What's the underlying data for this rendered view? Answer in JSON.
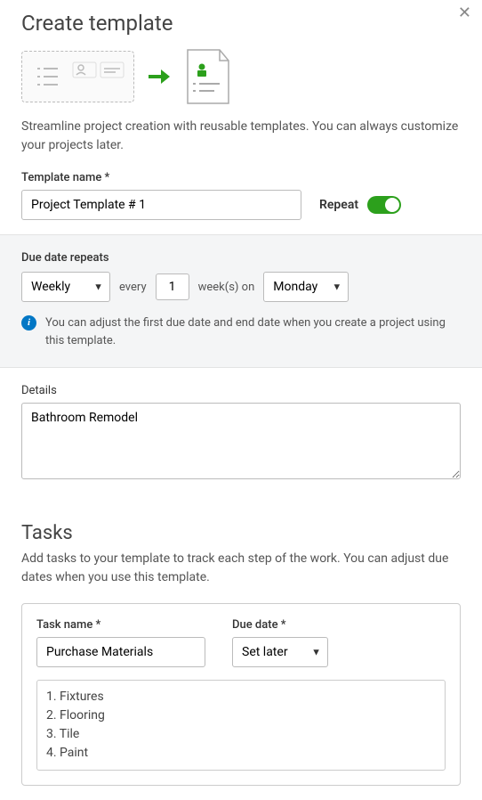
{
  "header": {
    "title": "Create template"
  },
  "description": "Streamline project creation with reusable templates. You can always customize your projects later.",
  "template_name": {
    "label": "Template name *",
    "value": "Project Template # 1"
  },
  "repeat": {
    "label": "Repeat",
    "on": true
  },
  "due_repeat": {
    "label": "Due date repeats",
    "frequency": "Weekly",
    "every_label": "every",
    "interval": "1",
    "unit_text": "week(s) on",
    "day": "Monday",
    "info": "You can adjust the first due date and end date when you create a project using this template."
  },
  "details": {
    "label": "Details",
    "value": "Bathroom Remodel"
  },
  "tasks": {
    "heading": "Tasks",
    "description": "Add tasks to your template to track each step of the work. You can adjust due dates when you use this template.",
    "task_name_label": "Task name *",
    "task_name_value": "Purchase Materials",
    "due_date_label": "Due date *",
    "due_date_value": "Set later",
    "list": [
      "1. Fixtures",
      "2. Flooring",
      "3. Tile",
      "4. Paint"
    ]
  },
  "colors": {
    "accent": "#2ca01c",
    "info": "#0277c5"
  }
}
